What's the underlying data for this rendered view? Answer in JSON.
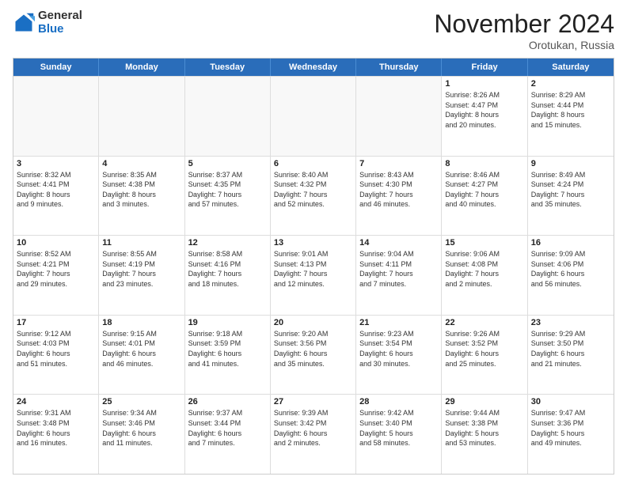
{
  "header": {
    "logo_general": "General",
    "logo_blue": "Blue",
    "month_title": "November 2024",
    "location": "Orotukan, Russia"
  },
  "days_of_week": [
    "Sunday",
    "Monday",
    "Tuesday",
    "Wednesday",
    "Thursday",
    "Friday",
    "Saturday"
  ],
  "weeks": [
    [
      {
        "day": "",
        "info": ""
      },
      {
        "day": "",
        "info": ""
      },
      {
        "day": "",
        "info": ""
      },
      {
        "day": "",
        "info": ""
      },
      {
        "day": "",
        "info": ""
      },
      {
        "day": "1",
        "info": "Sunrise: 8:26 AM\nSunset: 4:47 PM\nDaylight: 8 hours\nand 20 minutes."
      },
      {
        "day": "2",
        "info": "Sunrise: 8:29 AM\nSunset: 4:44 PM\nDaylight: 8 hours\nand 15 minutes."
      }
    ],
    [
      {
        "day": "3",
        "info": "Sunrise: 8:32 AM\nSunset: 4:41 PM\nDaylight: 8 hours\nand 9 minutes."
      },
      {
        "day": "4",
        "info": "Sunrise: 8:35 AM\nSunset: 4:38 PM\nDaylight: 8 hours\nand 3 minutes."
      },
      {
        "day": "5",
        "info": "Sunrise: 8:37 AM\nSunset: 4:35 PM\nDaylight: 7 hours\nand 57 minutes."
      },
      {
        "day": "6",
        "info": "Sunrise: 8:40 AM\nSunset: 4:32 PM\nDaylight: 7 hours\nand 52 minutes."
      },
      {
        "day": "7",
        "info": "Sunrise: 8:43 AM\nSunset: 4:30 PM\nDaylight: 7 hours\nand 46 minutes."
      },
      {
        "day": "8",
        "info": "Sunrise: 8:46 AM\nSunset: 4:27 PM\nDaylight: 7 hours\nand 40 minutes."
      },
      {
        "day": "9",
        "info": "Sunrise: 8:49 AM\nSunset: 4:24 PM\nDaylight: 7 hours\nand 35 minutes."
      }
    ],
    [
      {
        "day": "10",
        "info": "Sunrise: 8:52 AM\nSunset: 4:21 PM\nDaylight: 7 hours\nand 29 minutes."
      },
      {
        "day": "11",
        "info": "Sunrise: 8:55 AM\nSunset: 4:19 PM\nDaylight: 7 hours\nand 23 minutes."
      },
      {
        "day": "12",
        "info": "Sunrise: 8:58 AM\nSunset: 4:16 PM\nDaylight: 7 hours\nand 18 minutes."
      },
      {
        "day": "13",
        "info": "Sunrise: 9:01 AM\nSunset: 4:13 PM\nDaylight: 7 hours\nand 12 minutes."
      },
      {
        "day": "14",
        "info": "Sunrise: 9:04 AM\nSunset: 4:11 PM\nDaylight: 7 hours\nand 7 minutes."
      },
      {
        "day": "15",
        "info": "Sunrise: 9:06 AM\nSunset: 4:08 PM\nDaylight: 7 hours\nand 2 minutes."
      },
      {
        "day": "16",
        "info": "Sunrise: 9:09 AM\nSunset: 4:06 PM\nDaylight: 6 hours\nand 56 minutes."
      }
    ],
    [
      {
        "day": "17",
        "info": "Sunrise: 9:12 AM\nSunset: 4:03 PM\nDaylight: 6 hours\nand 51 minutes."
      },
      {
        "day": "18",
        "info": "Sunrise: 9:15 AM\nSunset: 4:01 PM\nDaylight: 6 hours\nand 46 minutes."
      },
      {
        "day": "19",
        "info": "Sunrise: 9:18 AM\nSunset: 3:59 PM\nDaylight: 6 hours\nand 41 minutes."
      },
      {
        "day": "20",
        "info": "Sunrise: 9:20 AM\nSunset: 3:56 PM\nDaylight: 6 hours\nand 35 minutes."
      },
      {
        "day": "21",
        "info": "Sunrise: 9:23 AM\nSunset: 3:54 PM\nDaylight: 6 hours\nand 30 minutes."
      },
      {
        "day": "22",
        "info": "Sunrise: 9:26 AM\nSunset: 3:52 PM\nDaylight: 6 hours\nand 25 minutes."
      },
      {
        "day": "23",
        "info": "Sunrise: 9:29 AM\nSunset: 3:50 PM\nDaylight: 6 hours\nand 21 minutes."
      }
    ],
    [
      {
        "day": "24",
        "info": "Sunrise: 9:31 AM\nSunset: 3:48 PM\nDaylight: 6 hours\nand 16 minutes."
      },
      {
        "day": "25",
        "info": "Sunrise: 9:34 AM\nSunset: 3:46 PM\nDaylight: 6 hours\nand 11 minutes."
      },
      {
        "day": "26",
        "info": "Sunrise: 9:37 AM\nSunset: 3:44 PM\nDaylight: 6 hours\nand 7 minutes."
      },
      {
        "day": "27",
        "info": "Sunrise: 9:39 AM\nSunset: 3:42 PM\nDaylight: 6 hours\nand 2 minutes."
      },
      {
        "day": "28",
        "info": "Sunrise: 9:42 AM\nSunset: 3:40 PM\nDaylight: 5 hours\nand 58 minutes."
      },
      {
        "day": "29",
        "info": "Sunrise: 9:44 AM\nSunset: 3:38 PM\nDaylight: 5 hours\nand 53 minutes."
      },
      {
        "day": "30",
        "info": "Sunrise: 9:47 AM\nSunset: 3:36 PM\nDaylight: 5 hours\nand 49 minutes."
      }
    ]
  ]
}
